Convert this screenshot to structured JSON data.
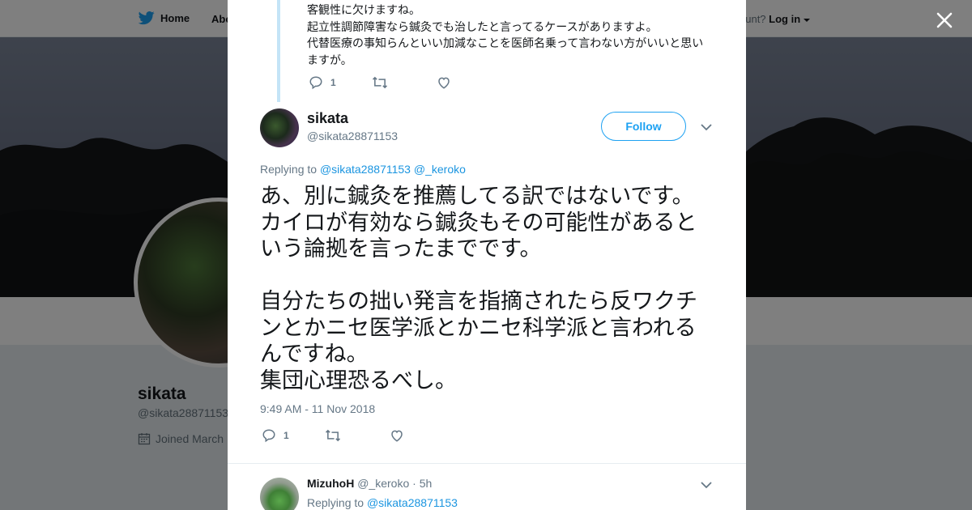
{
  "background_page": {
    "nav": {
      "home_label": "Home",
      "about_label": "Abo",
      "login_prefix": "ccount?",
      "login_label": "Log in"
    },
    "profile": {
      "name": "sikata",
      "handle": "@sikata28871153",
      "joined": "Joined March"
    }
  },
  "modal": {
    "previous_tweet": {
      "lines": [
        "客観性に欠けますね。",
        "起立性調節障害なら鍼灸でも治したと言ってるケースがありますよ。",
        "代替医療の事知らんといい加減なことを医師名乗って言わない方がいいと思い",
        "ますが。"
      ],
      "reply_count": "1"
    },
    "main_tweet": {
      "author_name": "sikata",
      "author_handle": "@sikata28871153",
      "follow_label": "Follow",
      "replying_prefix": "Replying to",
      "replying_to": [
        "@sikata28871153",
        "@_keroko"
      ],
      "text_lines": [
        "あ、別に鍼灸を推薦してる訳ではないです。",
        "カイロが有効なら鍼灸もその可能性があると",
        "いう論拠を言ったまでです。",
        "",
        "自分たちの拙い発言を指摘されたら反ワクチ",
        "ンとかニセ医学派とかニセ科学派と言われる",
        "んですね。",
        "集団心理恐るべし。"
      ],
      "timestamp": "9:49 AM - 11 Nov 2018",
      "reply_count": "1"
    },
    "reply_tweet": {
      "author_name": "MizuhoH",
      "author_handle": "@_keroko",
      "time_sep": "·",
      "time": "5h",
      "replying_prefix": "Replying to",
      "replying_to": "@sikata28871153"
    }
  },
  "colors": {
    "accent": "#1da1f2",
    "link": "#1b95e0",
    "muted": "#657786",
    "thread_line": "#c4e4f7"
  }
}
